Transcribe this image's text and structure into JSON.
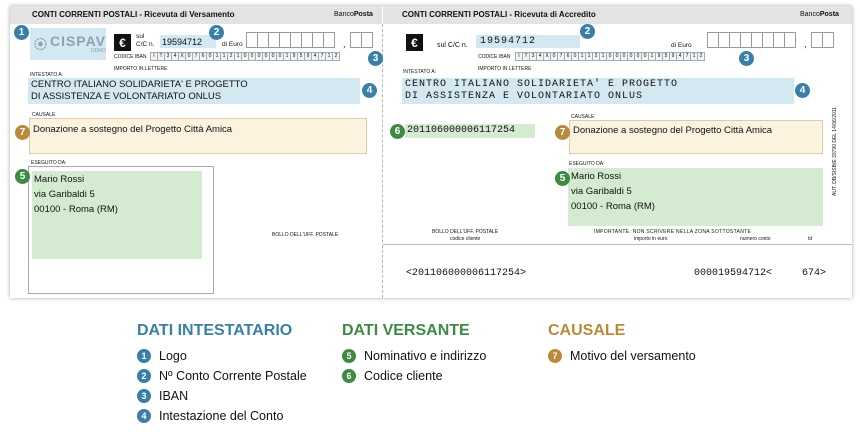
{
  "slip": {
    "left": {
      "title": "CONTI CORRENTI POSTALI",
      "subtitle": "- Ricevuta di Versamento",
      "brand_a": "Banco",
      "brand_b": "Posta",
      "logo_text": "CISPAV",
      "logo_sub": "DEMO",
      "sul_label": "sul",
      "cc_label": "C/C n.",
      "cc_number": "19594712",
      "euro_label": "di Euro",
      "iban_label": "CODICE IBAN",
      "iban_digits": [
        "I",
        "T",
        "3",
        "4",
        "X",
        "0",
        "7",
        "6",
        "0",
        "1",
        "1",
        "2",
        "1",
        "0",
        "0",
        "0",
        "0",
        "0",
        "0",
        "1",
        "9",
        "5",
        "9",
        "4",
        "7",
        "1",
        "2"
      ],
      "importo_label": "IMPORTO IN LETTERE",
      "intestato_label": "INTESTATO A:",
      "intestatario": "CENTRO ITALIANO SOLIDARIETA' E PROGETTO\nDI ASSISTENZA E VOLONTARIATO ONLUS",
      "causale_label": "CAUSALE",
      "causale": "Donazione a sostegno del Progetto Città Amica",
      "eseguito_label": "ESEGUITO DA:",
      "versante": "Mario Rossi\nvia Garibaldi 5\n00100 - Roma (RM)",
      "bollo": "BOLLO DELL'UFF. POSTALE"
    },
    "right": {
      "title": "CONTI CORRENTI POSTALI",
      "subtitle": "- Ricevuta di Accredito",
      "brand_a": "Banco",
      "brand_b": "Posta",
      "cc_label": "sul C/C n.",
      "cc_number": "19594712",
      "euro_label": "di Euro",
      "iban_label": "CODICE IBAN",
      "importo_label": "IMPORTO IN LETTERE",
      "intestato_label": "INTESTATO A:",
      "intestatario": "CENTRO ITALIANO SOLIDARIETA' E PROGETTO\nDI ASSISTENZA E VOLONTARIATO ONLUS",
      "codice_cliente": "201106000006117254",
      "causale_label": "CAUSALE",
      "causale": "Donazione a sostegno del Progetto Città Amica",
      "eseguito_label": "ESEGUITO DA:",
      "versante": "Mario Rossi\nvia Garibaldi 5\n00100 - Roma (RM)",
      "aut_text": "AUT. DB/SISB/E 33790 DEL 14/06/2011",
      "bollo": "BOLLO DELL'UFF. POSTALE",
      "bollo_sub": "codice cliente",
      "importante": "IMPORTANTE: NON SCRIVERE NELLA ZONA SOTTOSTANTE",
      "col_importo": "importo in euro",
      "col_numero": "numero conto",
      "col_td": "td",
      "ocr_left": "<201106000006117254>",
      "ocr_mid": "000019594712<",
      "ocr_right": "674>"
    }
  },
  "badges": {
    "n1": "1",
    "n2": "2",
    "n3": "3",
    "n4": "4",
    "n5": "5",
    "n6": "6",
    "n7": "7"
  },
  "legend": {
    "intestatario": {
      "heading": "DATI INTESTATARIO",
      "items": [
        "Logo",
        "Nº Conto Corrente Postale",
        "IBAN",
        "Intestazione del Conto"
      ]
    },
    "versante": {
      "heading": "DATI VERSANTE",
      "items": [
        "Nominativo e indirizzo",
        "Codice cliente"
      ]
    },
    "causale": {
      "heading": "CAUSALE",
      "items": [
        "Motivo del versamento"
      ]
    }
  },
  "colors": {
    "blue": "#3a7fa6",
    "green": "#3f8a43",
    "gold": "#b98a3a",
    "box_blue": "#d4e8f2",
    "box_green": "#d5ebd1",
    "box_beige": "#fbf3dd"
  },
  "icons": {
    "logo": "cispav-logo",
    "euro": "euro-icon"
  }
}
